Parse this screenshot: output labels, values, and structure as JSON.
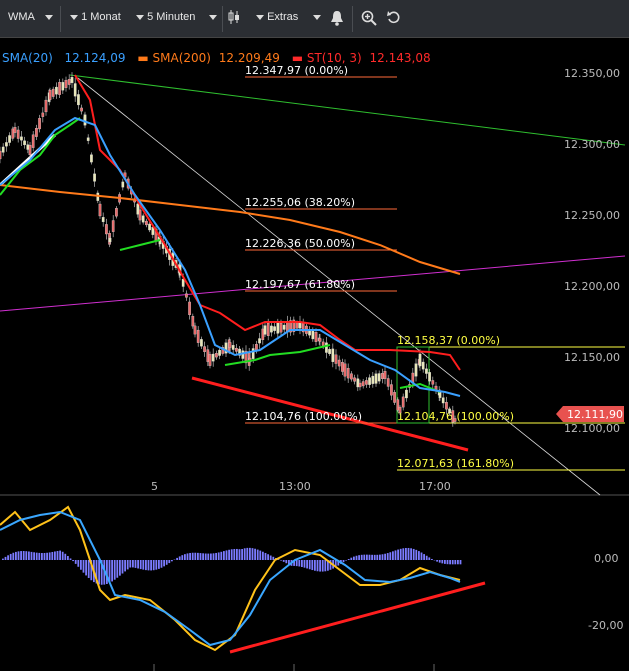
{
  "toolbar": {
    "chart_type": "WMA",
    "range": "1 Monat",
    "interval": "5 Minuten",
    "extras": "Extras"
  },
  "legend": {
    "sma20_label": "SMA(20)",
    "sma20_value": "12.124,09",
    "sma20_color": "#3aa0ff",
    "sma200_label": "SMA(200)",
    "sma200_value": "12.209,49",
    "sma200_color": "#ff7a1a",
    "st_label": "ST(10, 3)",
    "st_value": "12.143,08",
    "st_color": "#ff2a2a"
  },
  "price_axis": {
    "ticks": [
      "12.350,00",
      "12.300,00",
      "12.250,00",
      "12.200,00",
      "12.150,00",
      "12.100,00"
    ],
    "current_price": "12.111,90"
  },
  "time_axis": {
    "ticks": [
      "5",
      "13:00",
      "17:00"
    ]
  },
  "fib_levels_1": [
    {
      "label": "12.347,97 (0.00%)"
    },
    {
      "label": "12.255,06 (38.20%)"
    },
    {
      "label": "12.226,36 (50.00%)"
    },
    {
      "label": "12.197,67 (61.80%)"
    },
    {
      "label": "12.104,76 (100.00%)"
    }
  ],
  "fib_levels_2": [
    {
      "label": "12.158,37 (0.00%)"
    },
    {
      "label": "12.104,76 (100.00%)"
    },
    {
      "label": "12.071,63 (161.80%)"
    }
  ],
  "oscillator_axis": {
    "ticks": [
      "0,00",
      "-20,00"
    ]
  },
  "colors": {
    "sma20": "#3aa0ff",
    "sma200": "#ff7a1a",
    "supertrend_red": "#ff1e1e",
    "supertrend_green": "#22dd22",
    "fib_white": "#ffffff",
    "fib_yellow": "#ffff44",
    "trend_green": "#2fbf2f",
    "trend_magenta": "#d02fd0",
    "histogram": "#7b7bff",
    "osc_yellow": "#ffc21a",
    "osc_blue": "#3aa7ff"
  },
  "chart_data": {
    "type": "line",
    "series": [
      {
        "name": "SMA(20)",
        "last": 12124.09
      },
      {
        "name": "SMA(200)",
        "last": 12209.49
      },
      {
        "name": "ST(10, 3)",
        "last": 12143.08
      }
    ],
    "ylim": [
      12080,
      12365
    ],
    "y_ticks": [
      12350,
      12300,
      12250,
      12200,
      12150,
      12100
    ],
    "x_ticks": [
      "5",
      "13:00",
      "17:00"
    ],
    "grid": false,
    "legend": "top-left"
  }
}
